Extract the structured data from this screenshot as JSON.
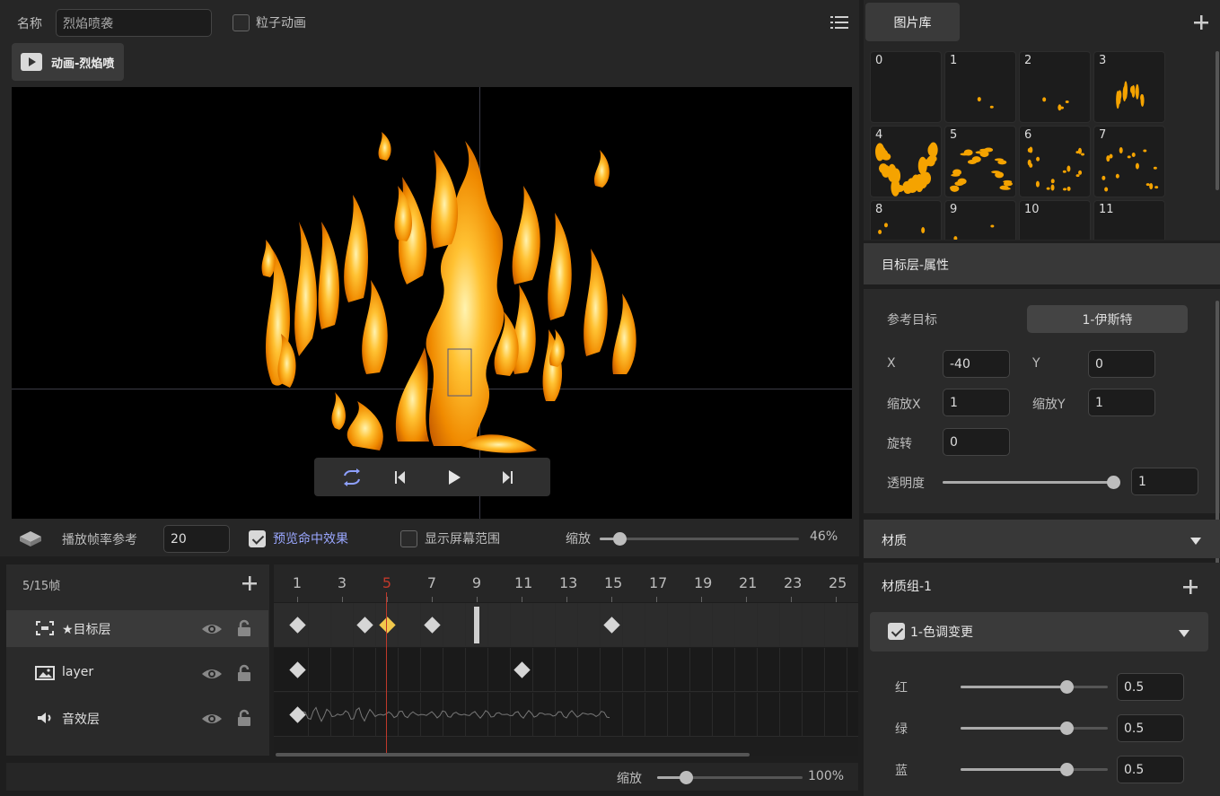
{
  "header": {
    "name_label": "名称",
    "name_value": "烈焰喷袭",
    "particle_label": "粒子动画",
    "menu_icon": "list-icon"
  },
  "anim_tab": {
    "label": "动画-烈焰喷",
    "icon": "play-icon"
  },
  "playback": {
    "loop_icon": "loop-icon",
    "prev_icon": "step-back-icon",
    "play_icon": "play-icon",
    "next_icon": "step-forward-icon"
  },
  "options": {
    "fps_label": "播放帧率参考",
    "fps_value": "20",
    "preview_hit_label": "预览命中效果",
    "preview_hit_checked": true,
    "screen_range_label": "显示屏幕范围",
    "screen_range_checked": false,
    "zoom_label": "缩放",
    "zoom_value": "46%",
    "zoom_fraction": 0.1
  },
  "timeline": {
    "frame_info": "5/15帧",
    "ruler": [
      "1",
      "3",
      "5",
      "7",
      "9",
      "11",
      "13",
      "15",
      "17",
      "19",
      "21",
      "23",
      "25"
    ],
    "current_frame": "5",
    "layers": [
      {
        "name": "★目标层",
        "icon": "target-icon",
        "keyframes": [
          1,
          4,
          5,
          7,
          15
        ],
        "marker": 9,
        "selected": true
      },
      {
        "name": "layer",
        "icon": "image-icon",
        "keyframes": [
          1,
          11
        ]
      },
      {
        "name": "音效层",
        "icon": "speaker-icon",
        "keyframes": [
          1
        ],
        "audio_to": 15
      }
    ],
    "zoom_label": "缩放",
    "zoom_value": "100%",
    "zoom_fraction": 0.2
  },
  "library": {
    "tab_label": "图片库",
    "items": [
      "0",
      "1",
      "2",
      "3",
      "4",
      "5",
      "6",
      "7",
      "8",
      "9",
      "10",
      "11"
    ]
  },
  "props": {
    "title": "目标层-属性",
    "ref_label": "参考目标",
    "ref_value": "1-伊斯特",
    "x_label": "X",
    "x_value": "-40",
    "y_label": "Y",
    "y_value": "0",
    "sx_label": "缩放X",
    "sx_value": "1",
    "sy_label": "缩放Y",
    "sy_value": "1",
    "rot_label": "旋转",
    "rot_value": "0",
    "alpha_label": "透明度",
    "alpha_value": "1",
    "alpha_fraction": 1.0
  },
  "material": {
    "title": "材质",
    "group_label": "材质组-1",
    "item_label": "1-色调变更",
    "item_checked": true,
    "r_label": "红",
    "r_value": "0.5",
    "r_fraction": 0.72,
    "g_label": "绿",
    "g_value": "0.5",
    "g_fraction": 0.72,
    "b_label": "蓝",
    "b_value": "0.5",
    "b_fraction": 0.72
  },
  "colors": {
    "accent_keyframe": "#f2c94c",
    "playhead": "#c0392b",
    "link_text": "#9aa7ff",
    "fire": "#f5a300"
  }
}
